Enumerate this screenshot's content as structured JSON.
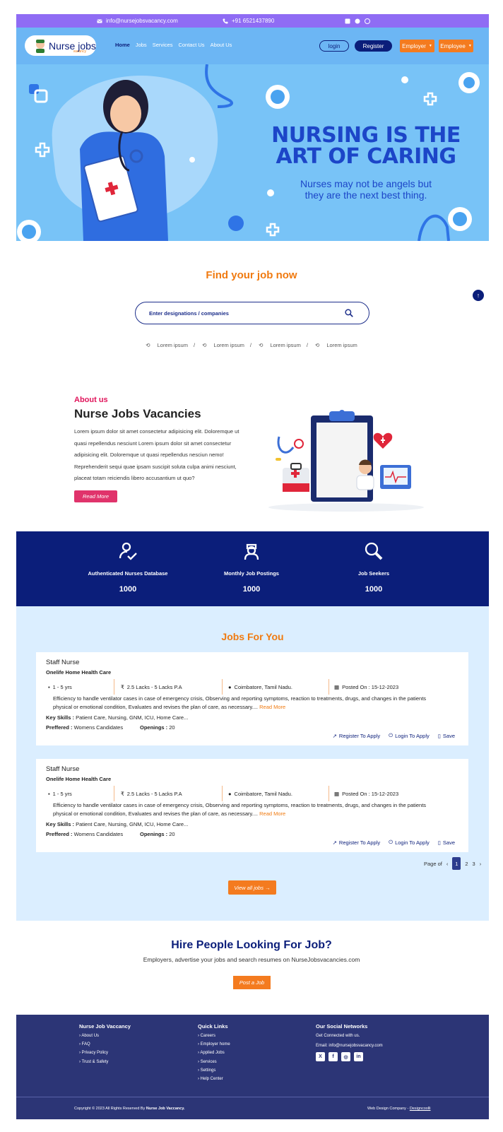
{
  "topbar": {
    "email": "info@nursejobsvacancy.com",
    "phone": "+91 6521437890"
  },
  "nav": {
    "logo_text": "Nurse jobs",
    "logo_sub": "vacancy",
    "menu": [
      "Home",
      "Jobs",
      "Services",
      "Contact Us",
      "About Us"
    ],
    "login": "login",
    "register": "Register",
    "employer": "Employer",
    "employee": "Employee"
  },
  "hero": {
    "headline_1": "NURSING IS THE",
    "headline_2": "ART OF CARING",
    "sub_1": "Nurses may not be angels but",
    "sub_2": "they are the next best thing."
  },
  "search": {
    "title": "Find your job now",
    "placeholder": "Enter designations / companies",
    "recent": [
      "Lorem ipsum",
      "Lorem ipsum",
      "Lorem ipsum",
      "Lorem ipsum"
    ]
  },
  "about": {
    "kicker": "About us",
    "title": "Nurse Jobs Vacancies",
    "text": "Lorem ipsum dolor sit amet consectetur adipisicing elit. Doloremque ut quasi repellendus nesciunt Lorem ipsum dolor sit amet consectetur adipisicing elit. Doloremque ut quasi repellendus nesciun nemo! Reprehenderit sequi quae ipsam suscipit soluta culpa animi nesciunt, placeat totam reiciendis libero accusantium ut quo?",
    "button": "Read More"
  },
  "stats": [
    {
      "label": "Authenticated Nurses Database",
      "value": "1000"
    },
    {
      "label": "Monthly Job Postings",
      "value": "1000"
    },
    {
      "label": "Job Seekers",
      "value": "1000"
    }
  ],
  "jobs": {
    "title": "Jobs For You",
    "items": [
      {
        "title": "Staff Nurse",
        "company": "Onelife Home Health Care",
        "experience": "1 - 5 yrs",
        "salary": "2.5 Lacks - 5 Lacks P.A",
        "location": "Coimbatore, Tamil Nadu.",
        "posted": "Posted On : 15-12-2023",
        "description": "Efficiency to handle ventilator cases in case of emergency crisis, Observing and reporting symptoms, reaction to treatments, drugs, and changes in the patients physical or emotional condition, Evaluates and revises the plan of care, as necessary....",
        "read_more": "Read More",
        "skills_label": "Key Skills :",
        "skills": "Patient Care, Nursing, GNM, ICU, Home Care...",
        "pref_label": "Preffered :",
        "preferred": "Womens Candidates",
        "openings_label": "Openings :",
        "openings": "20",
        "register_apply": "Register To Apply",
        "login_apply": "Login To Apply",
        "save": "Save"
      },
      {
        "title": "Staff Nurse",
        "company": "Onelife Home Health Care",
        "experience": "1 - 5 yrs",
        "salary": "2.5 Lacks - 5 Lacks P.A",
        "location": "Coimbatore, Tamil Nadu.",
        "posted": "Posted On : 15-12-2023",
        "description": "Efficiency to handle ventilator cases in case of emergency crisis, Observing and reporting symptoms, reaction to treatments, drugs, and changes in the patients physical or emotional condition, Evaluates and revises the plan of care, as necessary....",
        "read_more": "Read More",
        "skills_label": "Key Skills :",
        "skills": "Patient Care, Nursing, GNM, ICU, Home Care...",
        "pref_label": "Preffered :",
        "preferred": "Womens Candidates",
        "openings_label": "Openings :",
        "openings": "20",
        "register_apply": "Register To Apply",
        "login_apply": "Login To Apply",
        "save": "Save"
      }
    ],
    "pager": {
      "label": "Page of",
      "pages": [
        "1",
        "2",
        "3"
      ]
    },
    "view_all": "View all jobs"
  },
  "hire": {
    "title": "Hire People Looking For Job?",
    "sub": "Employers, advertise your jobs and search resumes on NurseJobsvacancies.com",
    "button": "Post a Job"
  },
  "footer": {
    "col1_title": "Nurse Job Vaccancy",
    "col1": [
      "About Us",
      "FAQ",
      "Privacy Policy",
      "Trust & Safety"
    ],
    "col2_title": "Quick Links",
    "col2": [
      "Careers",
      "Employer home",
      "Applied Jobs",
      "Services",
      "Settings",
      "Help Center"
    ],
    "col3_title": "Our Social Networks",
    "connected": "Get Connected with us.",
    "email": "Email: info@nursejobsvacancy.com",
    "copyright": "Copyright © 2023 All Rights Reserved By",
    "copyright_brand": "Nurse Job Vaccancy.",
    "design_label": "Web Design Company -",
    "design_company": "Designcoolli"
  },
  "colors": {
    "accent": "#f07a10",
    "navy": "#0b1e7a",
    "sky": "#78c3f7",
    "purple": "#8f6cf4"
  }
}
